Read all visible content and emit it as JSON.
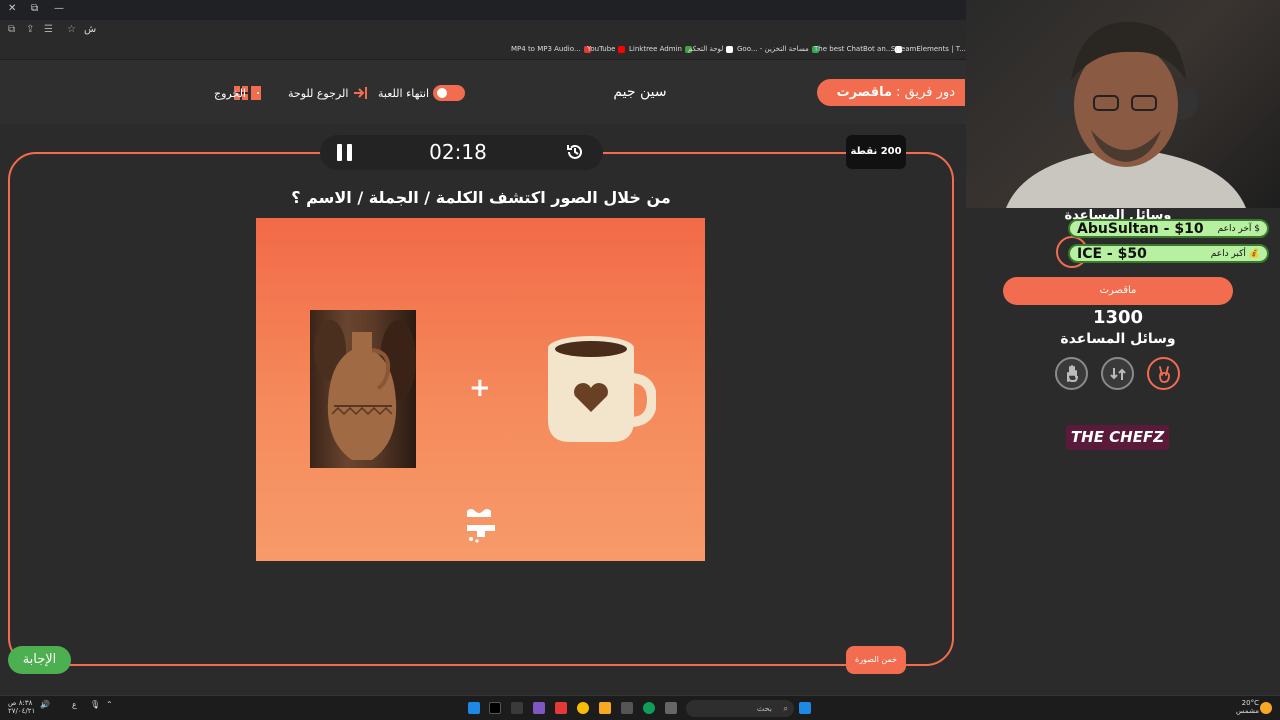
{
  "browser": {
    "address_text": "ش",
    "bookmarks": [
      {
        "label": "MP4 to MP3 Audio...",
        "color": "#e53935"
      },
      {
        "label": "YouTube",
        "color": "#ff0000"
      },
      {
        "label": "Linktree Admin",
        "color": "#43a047"
      },
      {
        "label": "لوحة التحكم",
        "color": "#ffffff"
      },
      {
        "label": "Goo... - مساحة التخزين",
        "color": "#34a853"
      },
      {
        "label": "The best ChatBot an...",
        "color": "#ffffff"
      },
      {
        "label": "StreamElements | T...",
        "color": "#7c4dff"
      }
    ]
  },
  "header": {
    "turn_prefix": "دور فريق :",
    "team_name": "ماقصرت",
    "game_name": "سين جيم",
    "end_game_label": "انتهاء اللعبة",
    "back_to_board_label": "الرجوع للوحة",
    "exit_label": "الخروج"
  },
  "board": {
    "timer": "02:18",
    "points": "200 نقطة",
    "question": "من خلال الصور اكتشف الكلمة / الجملة / الاسم ؟",
    "plus_sign": "+",
    "brand_logo_text": "سين جيم",
    "answer_label": "الإجابة",
    "guess_label": "خمن الصورة"
  },
  "side": {
    "aids_title_top": "وسائل المساعدة",
    "donors": [
      {
        "name": "AbuSultan - $10",
        "label": "آخر داعم",
        "icon": "dollar-icon"
      },
      {
        "name": "ICE - $50",
        "label": "أكبر داعم",
        "icon": "money-bag-icon"
      }
    ],
    "team_name": "ماقصرت",
    "score": "1300",
    "aids_title": "وسائل المساعدة",
    "aids": [
      {
        "icon": "hand-icon",
        "active": false
      },
      {
        "icon": "swap-icon",
        "active": false
      },
      {
        "icon": "two-fingers-icon",
        "active": true
      }
    ],
    "sponsor": "THE CHEFZ"
  },
  "taskbar": {
    "clock_time": "٨:٣٨ ص",
    "clock_date": "٢٧/٠٤/٢١",
    "lang": "ع",
    "search_placeholder": "بحث",
    "weather_temp": "20°C",
    "weather_desc": "مشمس"
  },
  "colors": {
    "accent": "#f26c4f",
    "green": "#4caf50",
    "background": "#2b2b2b"
  }
}
